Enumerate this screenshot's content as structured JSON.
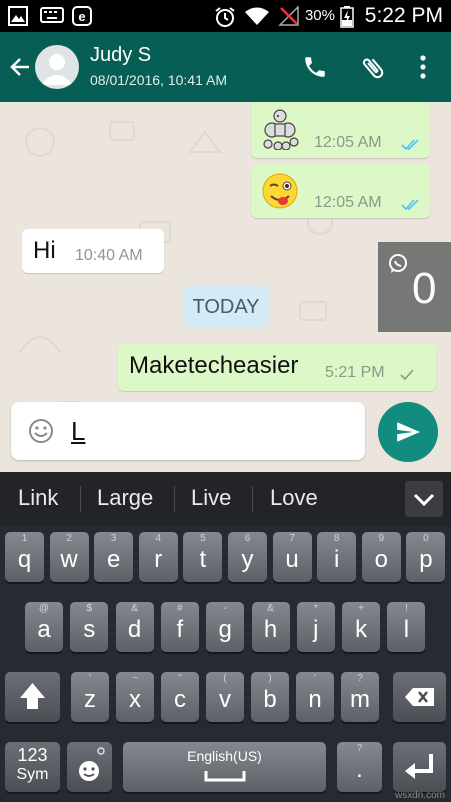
{
  "status_bar": {
    "battery_percent": "30%",
    "time": "5:22 PM",
    "icons": [
      "gallery-icon",
      "keyboard-icon",
      "e-app-icon",
      "alarm-icon",
      "wifi-icon",
      "no-signal-icon",
      "battery-charging-icon"
    ]
  },
  "header": {
    "contact_name": "Judy S",
    "last_seen": "08/01/2016, 10:41 AM",
    "icons": [
      "back-arrow-icon",
      "avatar-icon",
      "phone-icon",
      "attach-icon",
      "more-vert-icon"
    ]
  },
  "messages": [
    {
      "direction": "out",
      "content": "poodle-sticker",
      "time": "12:05 AM",
      "status": "read"
    },
    {
      "direction": "out",
      "content": "winking-tongue-emoji",
      "time": "12:05 AM",
      "status": "read"
    },
    {
      "direction": "in",
      "text": "Hi",
      "time": "10:40 AM"
    },
    {
      "direction": "out",
      "text": "Maketecheasier",
      "time": "5:21 PM",
      "status": "sent"
    }
  ],
  "date_divider": "TODAY",
  "floating_counter": "0",
  "composer": {
    "text": "L"
  },
  "suggestions": [
    "Link",
    "Large",
    "Live",
    "Love"
  ],
  "keyboard": {
    "row1": [
      {
        "k": "q",
        "h": "1"
      },
      {
        "k": "w",
        "h": "2"
      },
      {
        "k": "e",
        "h": "3"
      },
      {
        "k": "r",
        "h": "4"
      },
      {
        "k": "t",
        "h": "5"
      },
      {
        "k": "y",
        "h": "6"
      },
      {
        "k": "u",
        "h": "7"
      },
      {
        "k": "i",
        "h": "8"
      },
      {
        "k": "o",
        "h": "9"
      },
      {
        "k": "p",
        "h": "0"
      }
    ],
    "row2": [
      {
        "k": "a",
        "h": "@"
      },
      {
        "k": "s",
        "h": "$"
      },
      {
        "k": "d",
        "h": "&"
      },
      {
        "k": "f",
        "h": "#"
      },
      {
        "k": "g",
        "h": "-"
      },
      {
        "k": "h",
        "h": "&"
      },
      {
        "k": "j",
        "h": "*"
      },
      {
        "k": "k",
        "h": "+"
      },
      {
        "k": "l",
        "h": "!"
      }
    ],
    "row3": [
      {
        "k": "z",
        "h": "'"
      },
      {
        "k": "x",
        "h": "~"
      },
      {
        "k": "c",
        "h": "\""
      },
      {
        "k": "v",
        "h": "("
      },
      {
        "k": "b",
        "h": ")"
      },
      {
        "k": "n",
        "h": "'"
      },
      {
        "k": "m",
        "h": "?"
      }
    ],
    "sym_label_1": "123",
    "sym_label_2": "Sym",
    "space_label": "English(US)",
    "period": ".",
    "period_hint": "?"
  },
  "colors": {
    "header": "#075e54",
    "outgoing": "#dcf8c6",
    "incoming": "#ffffff",
    "send": "#128c7e",
    "read_ticks": "#4fc3f7"
  },
  "watermark": "wsxdn.com"
}
